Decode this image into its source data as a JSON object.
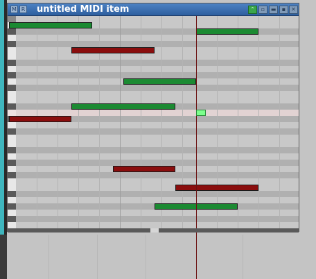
{
  "window": {
    "title": "untitled MIDI item",
    "sys_icons": [
      "M",
      "R"
    ],
    "buttons": [
      "restore-icon",
      "dock-icon",
      "minimize-icon",
      "maximize-icon",
      "close-icon"
    ]
  },
  "colors": {
    "note_green": "#1b8a32",
    "note_red": "#8a0d0d",
    "selected_note": "#7cff8c",
    "cursor": "#6b1010",
    "title_bar": "#2d5f9e"
  }
}
